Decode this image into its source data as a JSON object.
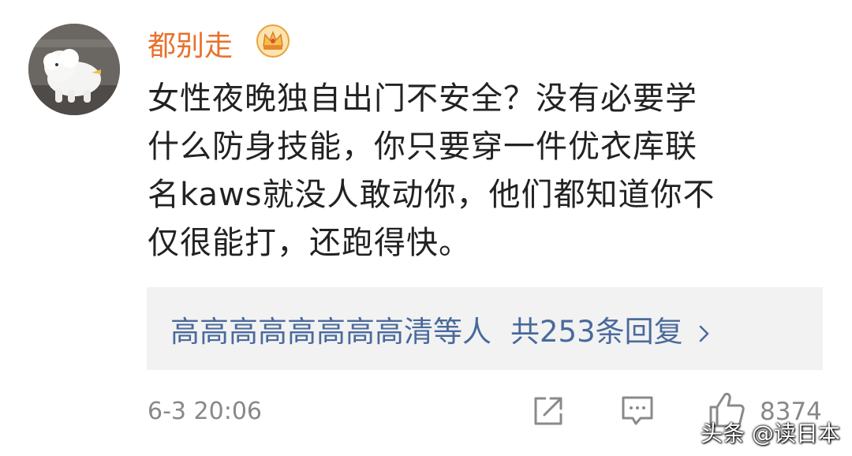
{
  "comment": {
    "user": {
      "name": "都别走",
      "badge_icon": "crown-icon",
      "avatar": "white-dog-photo"
    },
    "lines": [
      "女性夜晚独自出门不安全？没有必要学",
      "什么防身技能，你只要穿一件优衣库联",
      "名kaws就没人敢动你，他们都知道你不",
      "仅很能打，还跑得快。"
    ],
    "replies": {
      "users": "高高高高高高高高清",
      "suffix": "等人",
      "total": "共253条回复",
      "chevron_icon": "chevron-right-icon"
    },
    "timestamp": "6-3 20:06",
    "actions": {
      "share_icon": "share-icon",
      "comment_icon": "comment-icon",
      "like_icon": "thumbs-up-icon",
      "like_count": "8374"
    }
  },
  "watermark": "头条 @读日本",
  "colors": {
    "username": "#e8712c",
    "reply_link": "#4a6a9c",
    "reply_bg": "#f2f2f2",
    "meta_text": "#888888",
    "body_text": "#222222"
  }
}
